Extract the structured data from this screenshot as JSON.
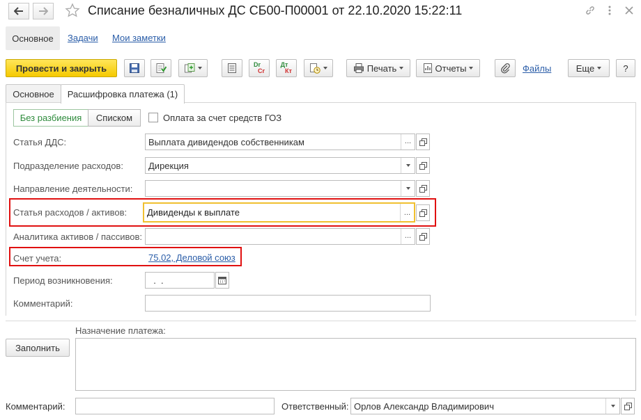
{
  "window": {
    "title": "Списание безналичных ДС СБ00-П00001 от 22.10.2020 15:22:11"
  },
  "subnav": {
    "active": "Основное",
    "links": [
      "Задачи",
      "Мои заметки"
    ]
  },
  "toolbar": {
    "primary": "Провести и закрыть",
    "print": "Печать",
    "reports": "Отчеты",
    "files": "Файлы",
    "more": "Еще",
    "help": "?",
    "dt_kt_1_top": "Dr",
    "dt_kt_1_bottom": "Cr",
    "dt_kt_2_top": "Дт",
    "dt_kt_2_bottom": "Кт"
  },
  "tabs": [
    {
      "label": "Основное",
      "active": false
    },
    {
      "label": "Расшифровка платежа (1)",
      "active": true
    }
  ],
  "panel": {
    "segments": [
      "Без разбиения",
      "Списком"
    ],
    "checkbox_label": "Оплата за счет средств ГОЗ",
    "checkbox_checked": false,
    "fields": {
      "statya_dds": {
        "label": "Статья ДДС:",
        "value": "Выплата дивидендов собственникам"
      },
      "podrazdelenie": {
        "label": "Подразделение расходов:",
        "value": "Дирекция"
      },
      "napravlenie": {
        "label": "Направление деятельности:",
        "value": ""
      },
      "statya_rashodov": {
        "label": "Статья расходов / активов:",
        "value": "Дивиденды к выплате"
      },
      "analitika": {
        "label": "Аналитика активов / пассивов:",
        "value": ""
      },
      "schet": {
        "label": "Счет учета:",
        "value": "75.02, Деловой союз"
      },
      "period": {
        "label": "Период возникновения:",
        "value": "  .  ."
      },
      "kommentariy": {
        "label": "Комментарий:",
        "value": ""
      }
    }
  },
  "bottom": {
    "fill_button": "Заполнить",
    "purpose_label": "Назначение платежа:",
    "purpose_value": "",
    "comment_label": "Комментарий:",
    "comment_value": "",
    "responsible_label": "Ответственный:",
    "responsible_value": "Орлов Александр Владимирович"
  },
  "colors": {
    "primary_button": "#f5c900",
    "link": "#2a5da8",
    "highlight_box": "#e01010",
    "active_field_border": "#f0c030",
    "segment_active_text": "#2e8b3c"
  }
}
